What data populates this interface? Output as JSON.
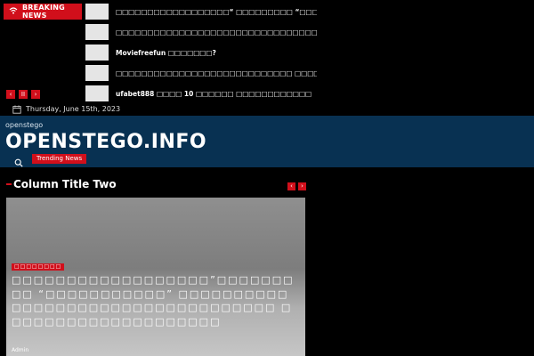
{
  "ticker": {
    "breaking_label": "BREAKING NEWS",
    "items": [
      {
        "title": "□□□□□□□□□□□□□□□□□□“ □□□□□□□□□ “□□□□□"
      },
      {
        "title": "□□□□□□□□□□□□□□□□□□□□□□□□□□□□□□□□□□□□"
      },
      {
        "title": "Moviefreefun □□□□□□□?"
      },
      {
        "title": "□□□□□□□□□□□□□□□□□□□□□□□□□□□□ □□□□□□"
      },
      {
        "title": "ufabet888 □□□□ 10 □□□□□□ □□□□□□□□□□□□"
      }
    ],
    "controls": {
      "prev": "‹",
      "pause": "II",
      "next": "›"
    }
  },
  "date": {
    "text": "Thursday, June 15th, 2023"
  },
  "header": {
    "subtitle": "openstego",
    "title": "OPENSTEGO.INFO",
    "trending_label": "Trending News"
  },
  "column": {
    "title": "Column Title Two",
    "nav": {
      "prev": "‹",
      "next": "›"
    }
  },
  "card": {
    "category": "□□□□□□□□",
    "title": "□□□□□□□□□□□□□□□□□□”□□□□□□□□□ “□□□□□□□□□□□” □□□□□□□□□□□□□□□□□□□□□□□□□□□□□□□□□□ □□□□□□□□□□□□□□□□□□□□",
    "author": "Admin"
  },
  "colors": {
    "accent": "#d10f1b",
    "header_bg": "#083152",
    "page_bg": "#000000"
  },
  "icons": [
    "wifi-icon",
    "calendar-icon",
    "search-icon",
    "pause-icon",
    "chevron-left-icon",
    "chevron-right-icon"
  ]
}
